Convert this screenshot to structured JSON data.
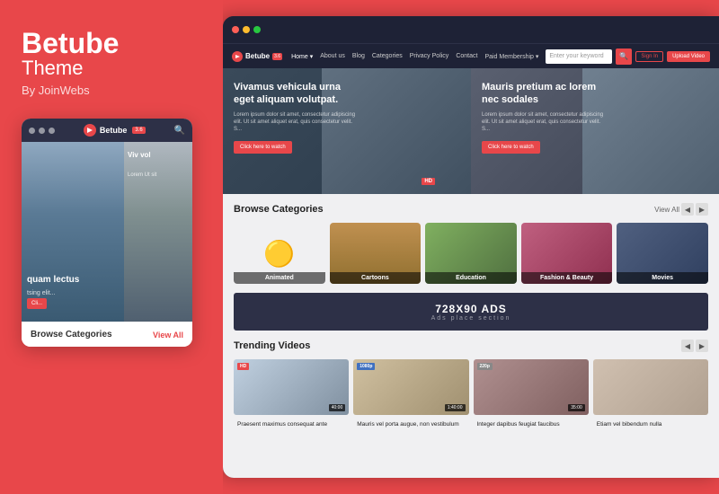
{
  "brand": {
    "title": "Betube",
    "subtitle": "Theme",
    "by": "By JoinWebs"
  },
  "nav": {
    "logo": "Betube",
    "badge": "3.6",
    "links": [
      "Home",
      "About us",
      "Blog",
      "Categories",
      "Privacy Policy",
      "Contact",
      "Paid Membership"
    ],
    "search_placeholder": "Enter your keyword",
    "signin": "Sign In",
    "upload": "Upload Video"
  },
  "hero": {
    "left": {
      "title": "Vivamus vehicula urna eget aliquam volutpat.",
      "desc": "Lorem ipsum dolor sit amet, consectetur adipiscing elit. Ut sit amet aliquet erat, quis consectetur velit. S...",
      "btn": "Click here to watch",
      "badge": "HD"
    },
    "right": {
      "title": "Mauris pretium ac lorem nec sodales",
      "desc": "Lorem ipsum dolor sit amet, consectetur adipiscing elit. Ut sit amet aliquet erat, quis consectetur velit. S...",
      "btn": "Click here to watch"
    }
  },
  "categories": {
    "section_title": "Browse Categories",
    "view_all": "View All",
    "items": [
      {
        "label": "Animated",
        "color": "animated"
      },
      {
        "label": "Cartoons",
        "color": "cartoons"
      },
      {
        "label": "Education",
        "color": "education"
      },
      {
        "label": "Fashion & Beauty",
        "color": "fashion"
      },
      {
        "label": "Movies",
        "color": "movies"
      }
    ]
  },
  "ads": {
    "title": "728X90 ADS",
    "subtitle": "Ads place section"
  },
  "trending": {
    "section_title": "Trending Videos",
    "items": [
      {
        "badge": "HD",
        "badge_type": "red",
        "time": "40:00",
        "title": "Praesent maximus consequat ante"
      },
      {
        "badge": "1080p",
        "badge_type": "blue",
        "time": "1:40:00",
        "title": "Mauris vel porta augue, non vestibulum"
      },
      {
        "badge": "220p",
        "badge_type": "gray",
        "time": "35:00",
        "title": "Integer dapibus feugiat faucibus"
      },
      {
        "badge": "",
        "badge_type": "none",
        "time": "",
        "title": "Etiam vel bibendum nulla"
      }
    ]
  },
  "mobile": {
    "logo": "Betube",
    "badge": "3.6",
    "hero_left_title": "quam lectus",
    "hero_left_sub": "tsing elit...",
    "hero_left_btn": "Cli...",
    "hero_right_title": "Viv vol",
    "hero_right_sub": "Lorem Ut sit",
    "footer_text": "Browse Categories",
    "footer_link": "View All"
  }
}
